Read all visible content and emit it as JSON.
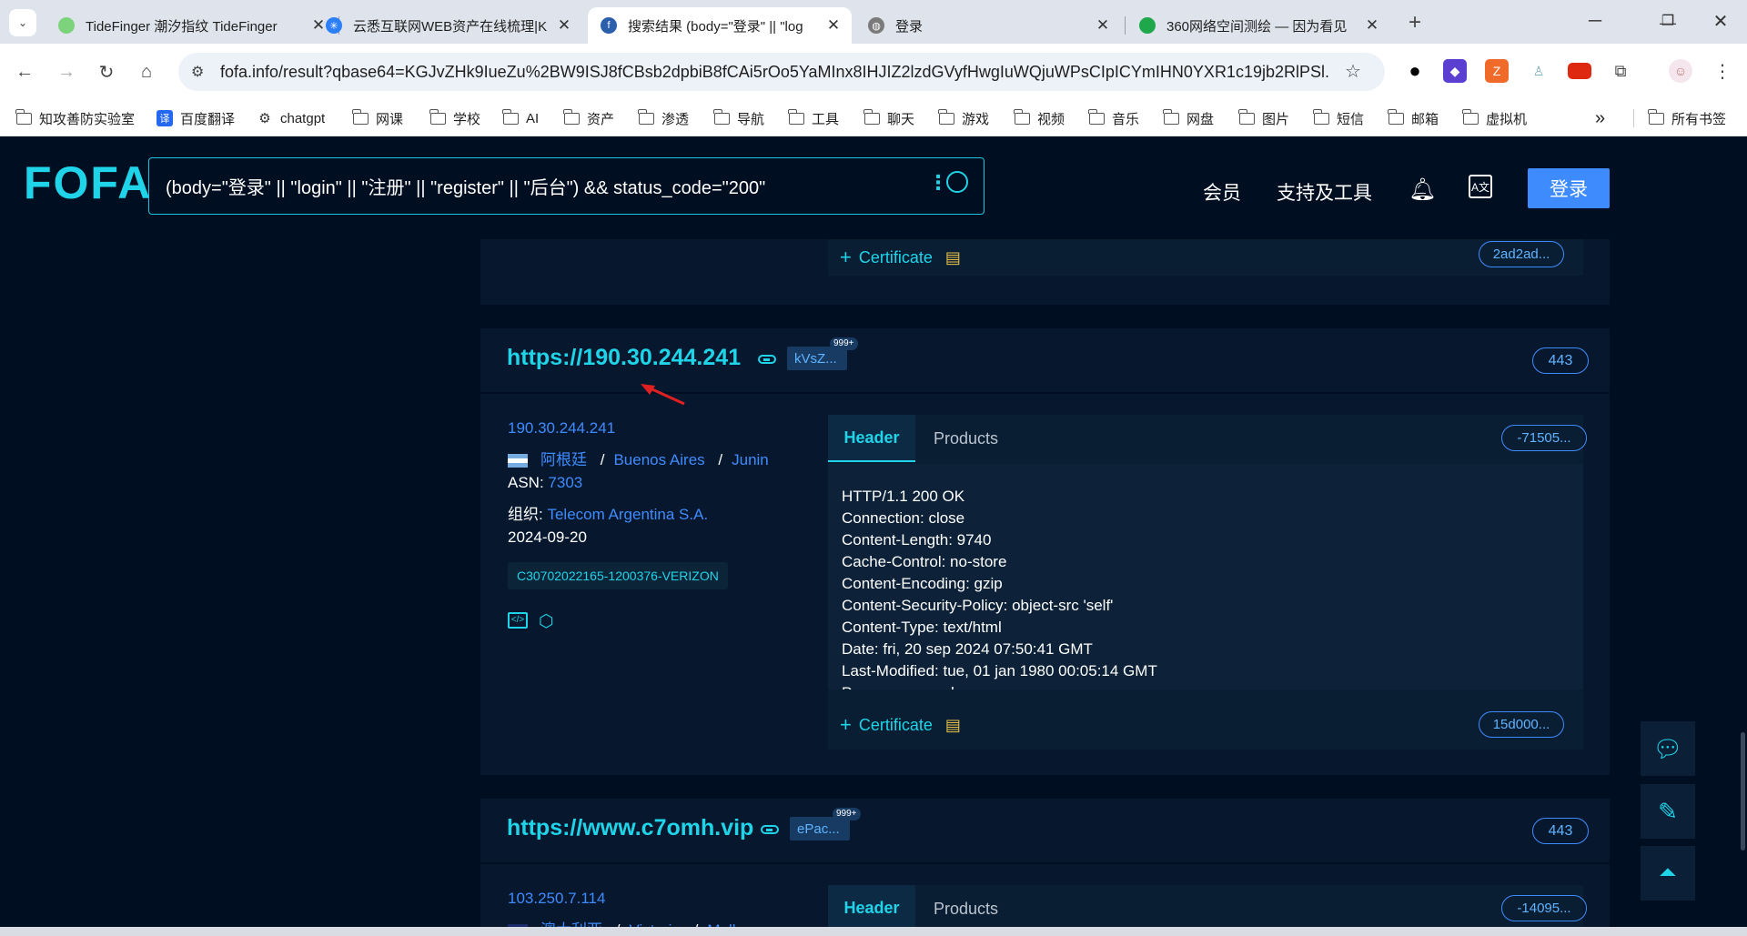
{
  "browser": {
    "tabs": [
      {
        "title": "TideFinger 潮汐指纹 TideFinger",
        "favicon": "#7cd37c"
      },
      {
        "title": "云悉互联网WEB资产在线梳理|K",
        "favicon": "#2d7ff9"
      },
      {
        "title": "搜索结果 (body=\"登录\" || \"log",
        "favicon": "#2b5fab"
      },
      {
        "title": "登录",
        "favicon": "#7a7a7a"
      },
      {
        "title": "360网络空间测绘 — 因为看见",
        "favicon": "#1fa84b"
      }
    ],
    "address": "fofa.info/result?qbase64=KGJvZHk9IueZu%2BW9ISJ8fCBsb2dpbiB8fCAi5rOo5YaMInx8IHJIZ2lzdGVyfHwgIuWQjuWPsCIpICYmIHN0YXR1c19jb2RlPSl...",
    "bookmarks": [
      "知攻善防实验室",
      "百度翻译",
      "chatgpt",
      "网课",
      "学校",
      "AI",
      "资产",
      "渗透",
      "导航",
      "工具",
      "聊天",
      "游戏",
      "视频",
      "音乐",
      "网盘",
      "图片",
      "短信",
      "邮箱",
      "虚拟机"
    ],
    "bookmarks_overflow": "»",
    "all_bookmarks": "所有书签"
  },
  "fofa": {
    "logo": "FOFA",
    "query": "(body=\"登录\" || \"login\" || \"注册\" || \"register\" || \"后台\") && status_code=\"200\"",
    "nav_member": "会员",
    "nav_tools": "支持及工具",
    "login": "登录"
  },
  "partial_card": {
    "cert_label": "Certificate",
    "cert_hash": "2ad2ad..."
  },
  "results": [
    {
      "url": "https://190.30.244.241",
      "tag": "kVsZ...",
      "tag_count": "999+",
      "port": "443",
      "ip": "190.30.244.241",
      "country": "阿根廷",
      "region": "Buenos Aires",
      "city": "Junin",
      "sep": "/",
      "asn_label": "ASN:",
      "asn": "7303",
      "org_label": "组织:",
      "org": "Telecom Argentina S.A.",
      "date": "2024-09-20",
      "product_tag": "C30702022165-1200376-VERIZON",
      "tab_header": "Header",
      "tab_products": "Products",
      "hash": "-71505...",
      "header_lines": [
        "HTTP/1.1 200 OK",
        "Connection: close",
        "Content-Length: 9740",
        "Cache-Control: no-store",
        "Content-Encoding: gzip",
        "Content-Security-Policy: object-src 'self'",
        "Content-Type: text/html",
        "Date: fri, 20 sep 2024 07:50:41 GMT",
        "Last-Modified: tue, 01 jan 1980 00:05:14 GMT",
        "Pragma: no-cache"
      ],
      "cert_label": "Certificate",
      "cert_hash": "15d000..."
    },
    {
      "url": "https://www.c7omh.vip",
      "tag": "ePac...",
      "tag_count": "999+",
      "port": "443",
      "ip": "103.250.7.114",
      "country": "澳大利亚",
      "region": "Victoria",
      "city": "Melbourne",
      "sep": "/",
      "tab_header": "Header",
      "tab_products": "Products",
      "hash": "-14095..."
    }
  ]
}
